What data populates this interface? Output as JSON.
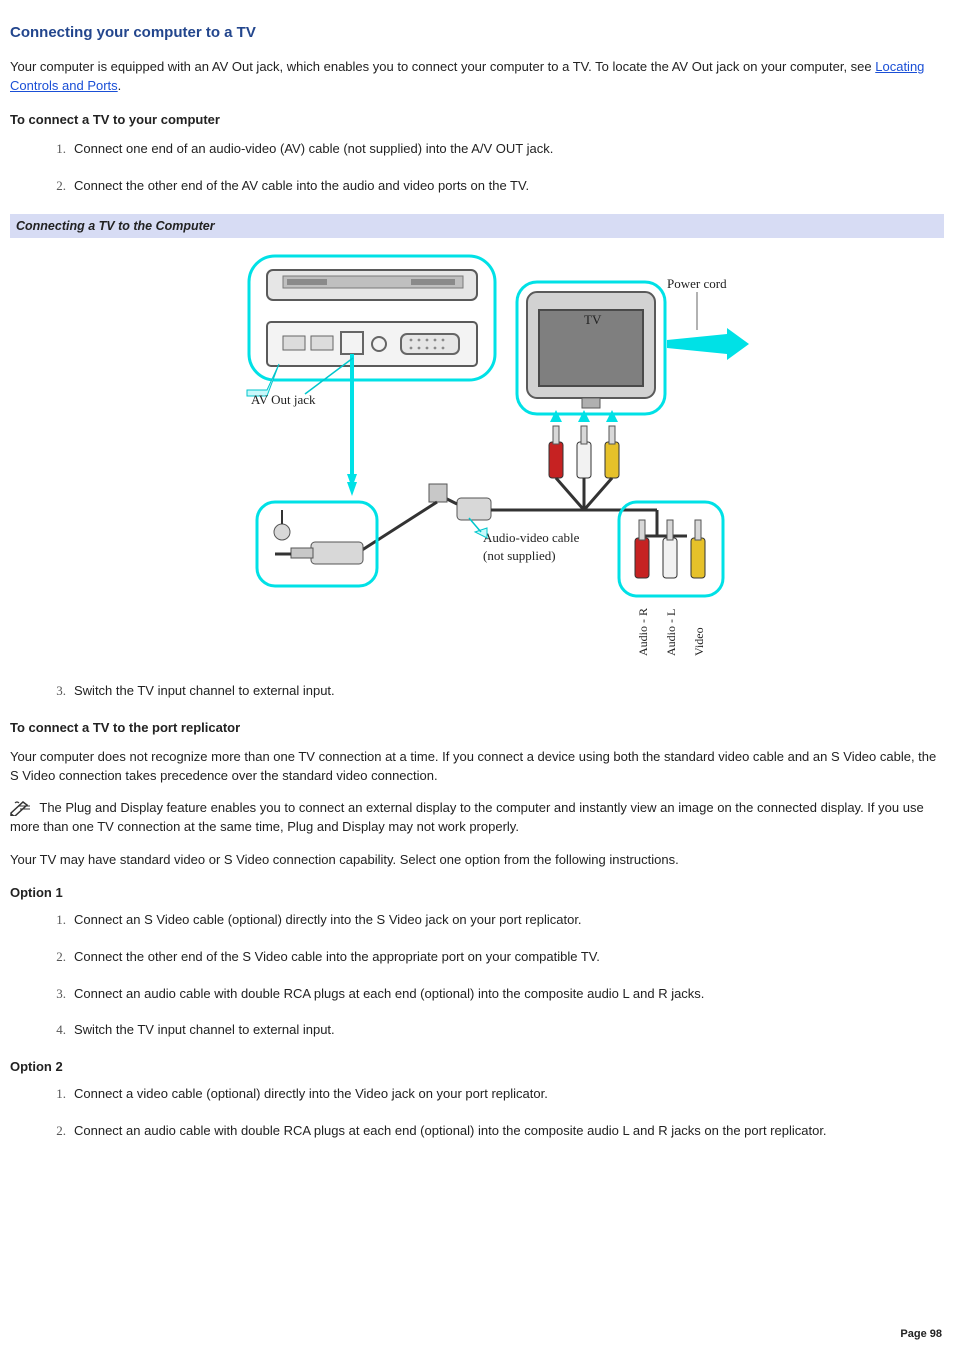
{
  "title": "Connecting your computer to a TV",
  "intro_pre": "Your computer is equipped with an AV Out jack, which enables you to connect your computer to a TV. To locate the AV Out jack on your computer, see ",
  "intro_link": "Locating Controls and Ports",
  "intro_post": ".",
  "section1": {
    "heading": "To connect a TV to your computer",
    "steps_a": [
      "Connect one end of an audio-video (AV) cable (not supplied) into the A/V OUT jack.",
      "Connect the other end of the AV cable into the audio and video ports on the TV."
    ],
    "figure_caption": "Connecting a TV to the Computer",
    "diagram_labels": {
      "av_out": "AV Out jack",
      "tv": "TV",
      "power_cord": "Power cord",
      "cable": "Audio-video cable",
      "cable_sub": "(not supplied)",
      "audio_r": "Audio - R",
      "audio_l": "Audio - L",
      "video": "Video"
    },
    "steps_b": [
      "Switch the TV input channel to external input."
    ],
    "steps_b_start": 3
  },
  "section2": {
    "heading": "To connect a TV to the port replicator",
    "p1": "Your computer does not recognize more than one TV connection at a time. If you connect a device using both the standard video cable and an S Video cable, the S Video connection takes precedence over the standard video connection.",
    "note": " The Plug and Display feature enables you to connect an external display to the computer and instantly view an image on the connected display. If you use more than one TV connection at the same time, Plug and Display may not work properly.",
    "p2": "Your TV may have standard video or S Video connection capability. Select one option from the following instructions.",
    "option1": {
      "heading": "Option 1",
      "steps": [
        "Connect an S Video cable (optional) directly into the S Video jack on your port replicator.",
        "Connect the other end of the S Video cable into the appropriate port on your compatible TV.",
        "Connect an audio cable with double RCA plugs at each end (optional) into the composite audio L and R jacks.",
        "Switch the TV input channel to external input."
      ]
    },
    "option2": {
      "heading": "Option 2",
      "steps": [
        "Connect a video cable (optional) directly into the Video jack on your port replicator.",
        "Connect an audio cable with double RCA plugs at each end (optional) into the composite audio L and R jacks on the port replicator."
      ]
    }
  },
  "page_number": "Page 98"
}
